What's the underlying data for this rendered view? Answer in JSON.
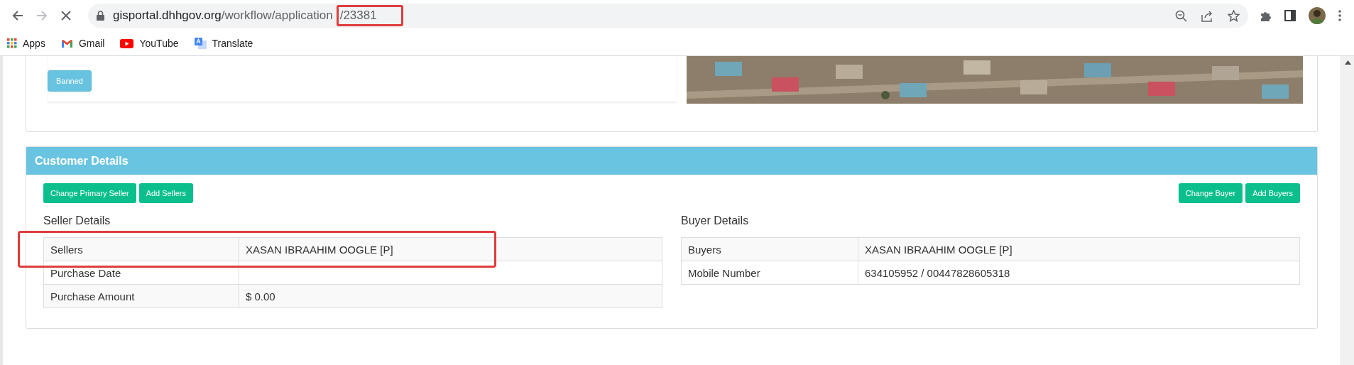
{
  "browser": {
    "url_host": "gisportal.dhhgov.org",
    "url_path": "/workflow/application",
    "url_tail": "/23381",
    "url_tail_highlighted": true,
    "loading": true
  },
  "bookmarks": [
    {
      "label": "Apps",
      "kind": "apps"
    },
    {
      "label": "Gmail",
      "kind": "gmail"
    },
    {
      "label": "YouTube",
      "kind": "youtube"
    },
    {
      "label": "Translate",
      "kind": "translate"
    }
  ],
  "property_card": {
    "status_button": "Banned"
  },
  "customer_details": {
    "title": "Customer Details",
    "seller_buttons": [
      "Change Primary Seller",
      "Add Sellers"
    ],
    "buyer_buttons": [
      "Change Buyer",
      "Add Buyers"
    ],
    "seller": {
      "heading": "Seller Details",
      "rows": [
        {
          "label": "Sellers",
          "value": "XASAN IBRAAHIM OOGLE [P]",
          "highlighted": true
        },
        {
          "label": "Purchase Date",
          "value": "",
          "highlighted": false
        },
        {
          "label": "Purchase Amount",
          "value": "$ 0.00",
          "highlighted": false
        }
      ]
    },
    "buyer": {
      "heading": "Buyer Details",
      "rows": [
        {
          "label": "Buyers",
          "value": "XASAN IBRAAHIM OOGLE [P]",
          "highlighted": false
        },
        {
          "label": "Mobile Number",
          "value": "634105952 / 00447828605318",
          "highlighted": false
        }
      ]
    }
  }
}
